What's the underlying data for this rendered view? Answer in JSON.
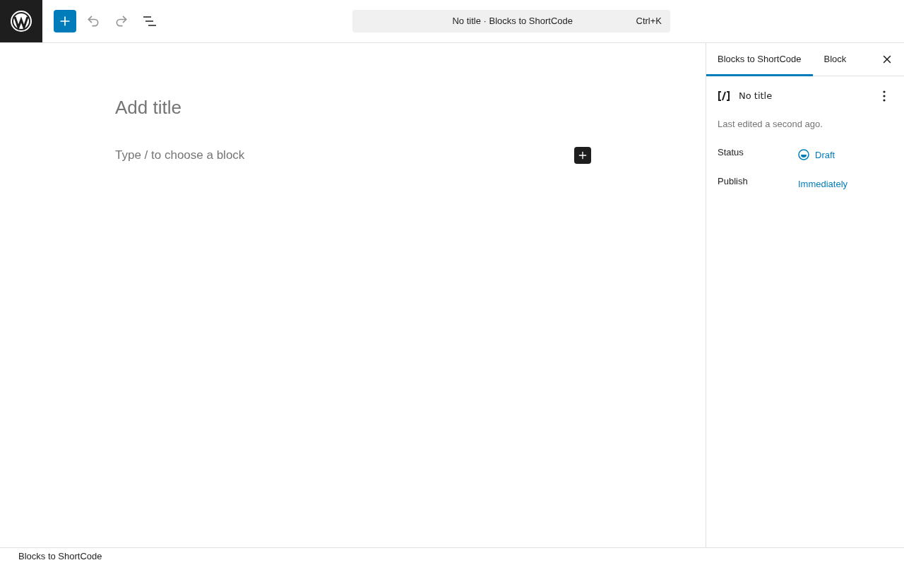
{
  "toolbar": {
    "undo_disabled": true,
    "redo_disabled": true
  },
  "command_bar": {
    "title": "No title · Blocks to ShortCode",
    "shortcut": "Ctrl+K"
  },
  "editor": {
    "title_placeholder": "Add title",
    "block_placeholder": "Type / to choose a block"
  },
  "sidebar": {
    "tabs": [
      {
        "label": "Blocks to ShortCode",
        "selected": true
      },
      {
        "label": "Block",
        "selected": false
      }
    ],
    "document": {
      "title": "No title",
      "last_edited": "Last edited a second ago."
    },
    "fields": [
      {
        "label": "Status",
        "value": "Draft",
        "kind": "status"
      },
      {
        "label": "Publish",
        "value": "Immediately",
        "kind": "link"
      }
    ]
  },
  "footer": {
    "breadcrumb": "Blocks to ShortCode"
  }
}
